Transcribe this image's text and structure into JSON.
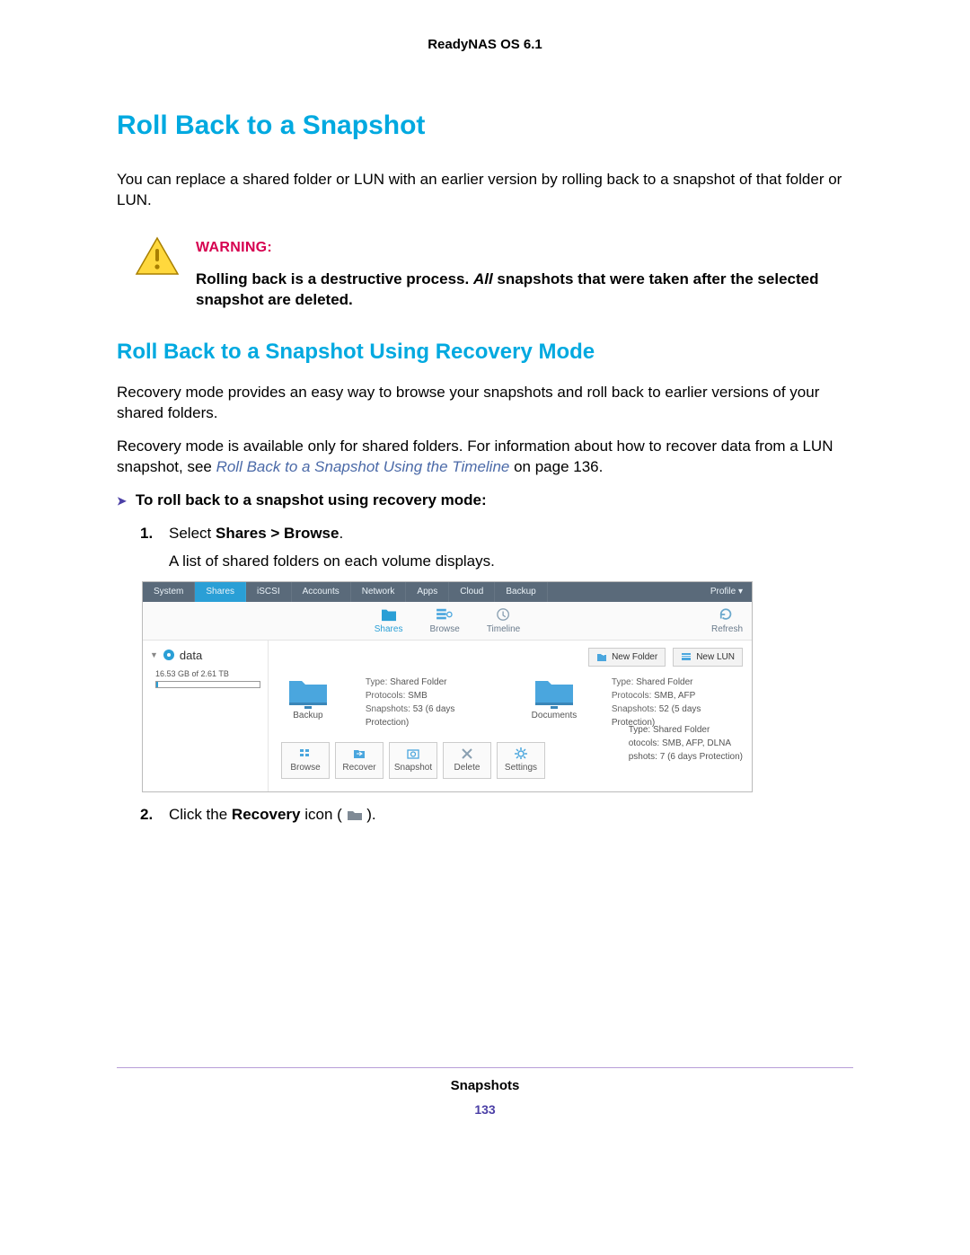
{
  "header": {
    "product": "ReadyNAS OS 6.1"
  },
  "h1": "Roll Back to a Snapshot",
  "intro": "You can replace a shared folder or LUN with an earlier version by rolling back to a snapshot of that folder or LUN.",
  "warning": {
    "label": "WARNING:",
    "line_pre": "Rolling back is a destructive process. ",
    "line_em": "All",
    "line_post": " snapshots that were taken after the selected snapshot are deleted."
  },
  "h2": "Roll Back to a Snapshot Using Recovery Mode",
  "p2": "Recovery mode provides an easy way to browse your snapshots and roll back to earlier versions of your shared folders.",
  "p3_pre": "Recovery mode is available only for shared folders. For information about how to recover data from a LUN snapshot, see ",
  "p3_link": "Roll Back to a Snapshot Using the Timeline",
  "p3_post": " on page 136.",
  "proc_head": "To roll back to a snapshot using recovery mode:",
  "step1": {
    "num": "1.",
    "pre": "Select ",
    "bold": "Shares > Browse",
    "post": ".",
    "sub": "A list of shared folders on each volume displays."
  },
  "step2": {
    "num": "2.",
    "pre": "Click the ",
    "bold": "Recovery",
    "post_a": " icon ( ",
    "post_b": " )."
  },
  "screenshot": {
    "nav": [
      "System",
      "Shares",
      "iSCSI",
      "Accounts",
      "Network",
      "Apps",
      "Cloud",
      "Backup"
    ],
    "active_nav": "Shares",
    "profile": "Profile ▾",
    "subnav": {
      "shares": "Shares",
      "browse": "Browse",
      "timeline": "Timeline",
      "refresh": "Refresh"
    },
    "volume": {
      "name": "data",
      "usage_text": "16.53 GB of 2.61 TB"
    },
    "buttons": {
      "new_folder": "New Folder",
      "new_lun": "New LUN"
    },
    "folder1": {
      "name": "Backup",
      "type_lbl": "Type:",
      "type_val": " Shared Folder",
      "proto_lbl": "Protocols:",
      "proto_val": " SMB",
      "snap_lbl": "Snapshots:",
      "snap_val": " 53 (6 days Protection)"
    },
    "folder2": {
      "name": "Documents",
      "type_lbl": "Type:",
      "type_val": " Shared Folder",
      "proto_lbl": "Protocols:",
      "proto_val": " SMB, AFP",
      "snap_lbl": "Snapshots:",
      "snap_val": " 52 (5 days Protection)"
    },
    "folder3": {
      "type_lbl": "Type:",
      "type_val": " Shared Folder",
      "proto_lbl": "otocols:",
      "proto_val": " SMB, AFP, DLNA",
      "snap_lbl": "pshots:",
      "snap_val": " 7 (6 days Protection)"
    },
    "toolbar": {
      "browse": "Browse",
      "recover": "Recover",
      "snapshot": "Snapshot",
      "delete": "Delete",
      "settings": "Settings"
    }
  },
  "footer": {
    "section": "Snapshots",
    "page": "133"
  }
}
